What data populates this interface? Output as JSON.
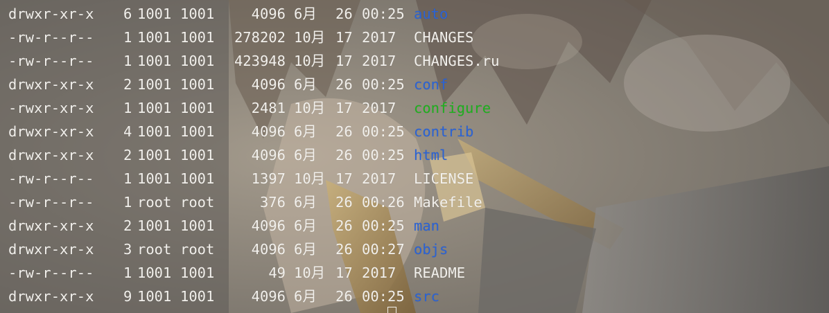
{
  "theme": {
    "text_color": "#f2f0ec",
    "dir_color": "#2a63d6",
    "exec_color": "#1fb01f",
    "background": "#7f7b75"
  },
  "listing": [
    {
      "perm": "drwxr-xr-x",
      "links": "6",
      "owner": "1001",
      "group": "1001",
      "size": "4096",
      "month": "6月",
      "day": "26",
      "time": "00:25",
      "name": "auto",
      "kind": "dir"
    },
    {
      "perm": "-rw-r--r--",
      "links": "1",
      "owner": "1001",
      "group": "1001",
      "size": "278202",
      "month": "10月",
      "day": "17",
      "time": "2017",
      "name": "CHANGES",
      "kind": "file"
    },
    {
      "perm": "-rw-r--r--",
      "links": "1",
      "owner": "1001",
      "group": "1001",
      "size": "423948",
      "month": "10月",
      "day": "17",
      "time": "2017",
      "name": "CHANGES.ru",
      "kind": "file"
    },
    {
      "perm": "drwxr-xr-x",
      "links": "2",
      "owner": "1001",
      "group": "1001",
      "size": "4096",
      "month": "6月",
      "day": "26",
      "time": "00:25",
      "name": "conf",
      "kind": "dir"
    },
    {
      "perm": "-rwxr-xr-x",
      "links": "1",
      "owner": "1001",
      "group": "1001",
      "size": "2481",
      "month": "10月",
      "day": "17",
      "time": "2017",
      "name": "configure",
      "kind": "exec"
    },
    {
      "perm": "drwxr-xr-x",
      "links": "4",
      "owner": "1001",
      "group": "1001",
      "size": "4096",
      "month": "6月",
      "day": "26",
      "time": "00:25",
      "name": "contrib",
      "kind": "dir"
    },
    {
      "perm": "drwxr-xr-x",
      "links": "2",
      "owner": "1001",
      "group": "1001",
      "size": "4096",
      "month": "6月",
      "day": "26",
      "time": "00:25",
      "name": "html",
      "kind": "dir"
    },
    {
      "perm": "-rw-r--r--",
      "links": "1",
      "owner": "1001",
      "group": "1001",
      "size": "1397",
      "month": "10月",
      "day": "17",
      "time": "2017",
      "name": "LICENSE",
      "kind": "file"
    },
    {
      "perm": "-rw-r--r--",
      "links": "1",
      "owner": "root",
      "group": "root",
      "size": "376",
      "month": "6月",
      "day": "26",
      "time": "00:26",
      "name": "Makefile",
      "kind": "file"
    },
    {
      "perm": "drwxr-xr-x",
      "links": "2",
      "owner": "1001",
      "group": "1001",
      "size": "4096",
      "month": "6月",
      "day": "26",
      "time": "00:25",
      "name": "man",
      "kind": "dir"
    },
    {
      "perm": "drwxr-xr-x",
      "links": "3",
      "owner": "root",
      "group": "root",
      "size": "4096",
      "month": "6月",
      "day": "26",
      "time": "00:27",
      "name": "objs",
      "kind": "dir"
    },
    {
      "perm": "-rw-r--r--",
      "links": "1",
      "owner": "1001",
      "group": "1001",
      "size": "49",
      "month": "10月",
      "day": "17",
      "time": "2017",
      "name": "README",
      "kind": "file"
    },
    {
      "perm": "drwxr-xr-x",
      "links": "9",
      "owner": "1001",
      "group": "1001",
      "size": "4096",
      "month": "6月",
      "day": "26",
      "time": "00:25",
      "name": "src",
      "kind": "dir"
    }
  ]
}
